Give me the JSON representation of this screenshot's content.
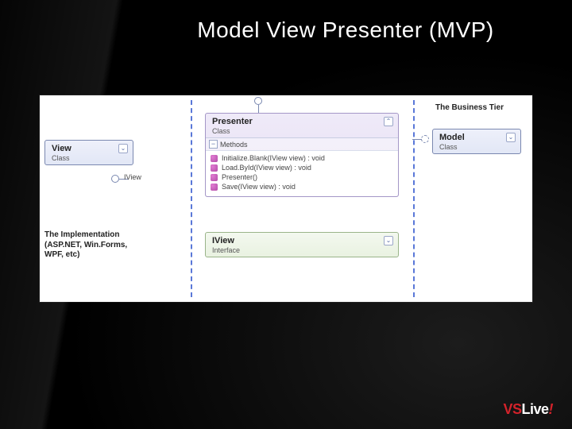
{
  "title": "Model View Presenter (MVP)",
  "labels": {
    "implementation_line1": "The Implementation",
    "implementation_line2": "(ASP.NET, Win.Forms,",
    "implementation_line3": "WPF, etc)",
    "business_tier": "The Business Tier"
  },
  "boxes": {
    "view": {
      "name": "View",
      "stereotype": "Class"
    },
    "presenter": {
      "name": "Presenter",
      "stereotype": "Class",
      "section": "Methods"
    },
    "iview": {
      "name": "IView",
      "stereotype": "Interface"
    },
    "model": {
      "name": "Model",
      "stereotype": "Class"
    }
  },
  "presenter_methods": [
    "Initialize.Blank(IView view) : void",
    "Load.ById(IView view) : void",
    "Presenter()",
    "Save(IView view) : void"
  ],
  "iview_lollipop_label": "IView",
  "logo": {
    "vs": "VS",
    "live": "Live",
    "excl": "!"
  }
}
